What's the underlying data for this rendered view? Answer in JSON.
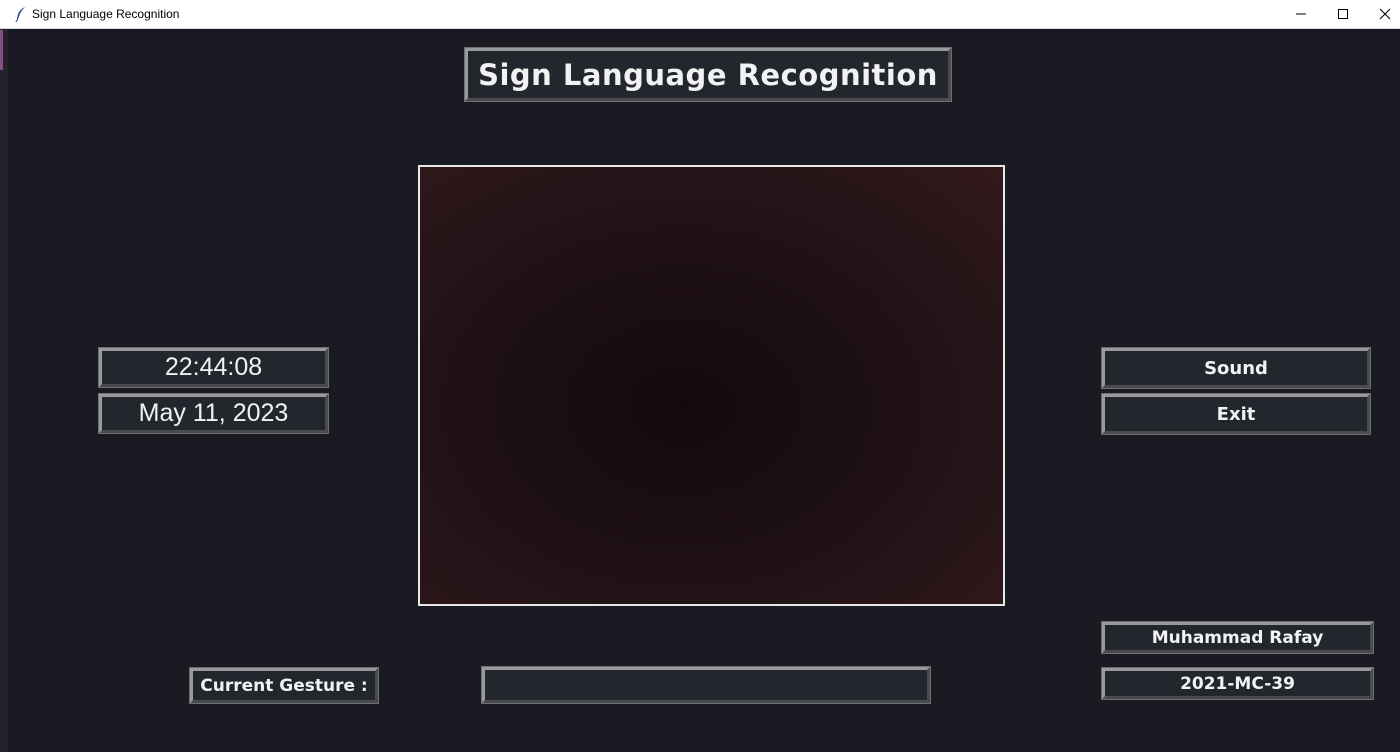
{
  "window": {
    "title": "Sign Language Recognition"
  },
  "header": {
    "title": "Sign Language Recognition"
  },
  "clock": {
    "time": "22:44:08",
    "date": "May 11, 2023"
  },
  "controls": {
    "sound_label": "Sound",
    "exit_label": "Exit"
  },
  "author": {
    "name": "Muhammad Rafay",
    "id": "2021-MC-39"
  },
  "gesture": {
    "label": "Current Gesture :",
    "value": ""
  },
  "colors": {
    "background": "#1a1a23",
    "box_fill": "#22272e",
    "text": "#f2f2f2"
  },
  "icons": [
    "feather-icon",
    "minimize-icon",
    "maximize-icon",
    "close-icon"
  ]
}
